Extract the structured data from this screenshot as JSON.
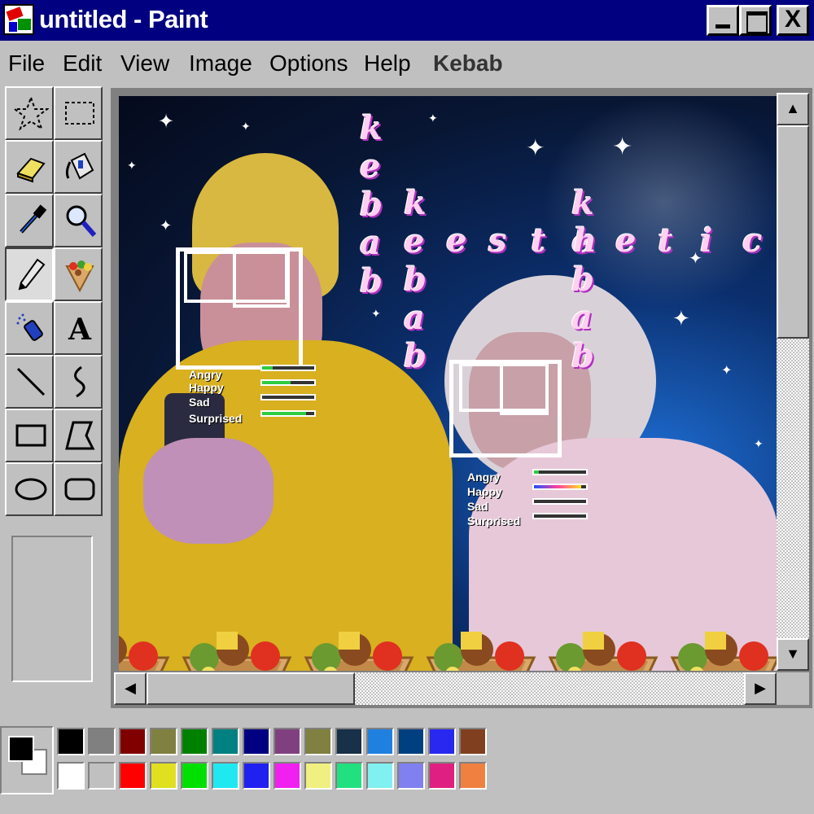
{
  "window": {
    "title": "untitled - Paint",
    "close_glyph": "X"
  },
  "menu": [
    {
      "label": "File"
    },
    {
      "label": "Edit"
    },
    {
      "label": "View"
    },
    {
      "label": "Image"
    },
    {
      "label": "Options"
    },
    {
      "label": "Help"
    },
    {
      "label": "Kebab"
    }
  ],
  "tools": [
    {
      "name": "free-form-select",
      "icon": "star-select-icon"
    },
    {
      "name": "select",
      "icon": "rect-select-icon"
    },
    {
      "name": "eraser",
      "icon": "eraser-icon"
    },
    {
      "name": "fill-with-color",
      "icon": "paint-bucket-icon"
    },
    {
      "name": "pick-color",
      "icon": "eyedropper-icon"
    },
    {
      "name": "magnifier",
      "icon": "magnifier-icon"
    },
    {
      "name": "pencil",
      "icon": "pencil-icon",
      "pressed": true
    },
    {
      "name": "kebab",
      "icon": "kebab-icon"
    },
    {
      "name": "airbrush",
      "icon": "airbrush-icon"
    },
    {
      "name": "text",
      "icon": "text-icon",
      "glyph": "A"
    },
    {
      "name": "line",
      "icon": "line-icon"
    },
    {
      "name": "curve",
      "icon": "curve-icon"
    },
    {
      "name": "rectangle",
      "icon": "rectangle-icon"
    },
    {
      "name": "polygon",
      "icon": "polygon-icon"
    },
    {
      "name": "ellipse",
      "icon": "ellipse-icon"
    },
    {
      "name": "rounded-rectangle",
      "icon": "rounded-rectangle-icon"
    }
  ],
  "canvas": {
    "emotion_panels": [
      {
        "labels": [
          "Angry",
          "Happy",
          "Sad",
          "Surprised"
        ],
        "levels": [
          0.2,
          0.55,
          0.0,
          0.85
        ]
      },
      {
        "labels": [
          "Angry",
          "Happy",
          "Sad",
          "Surprised"
        ],
        "levels": [
          0.1,
          0.9,
          0.0,
          0.0
        ]
      }
    ],
    "vertical_words": [
      "kebab",
      "kebab",
      "kebab"
    ],
    "horizontal_word": "kesthetics"
  },
  "palette": {
    "foreground": "#000000",
    "background": "#ffffff",
    "top_row": [
      "#000000",
      "#808080",
      "#800000",
      "#808040",
      "#008000",
      "#008080",
      "#000080",
      "#804080",
      "#808040",
      "#183048",
      "#2080e0",
      "#004080",
      "#2828f0",
      "#804020"
    ],
    "bottom_row": [
      "#ffffff",
      "#c0c0c0",
      "#ff0000",
      "#e0e020",
      "#00e000",
      "#20e8f0",
      "#2020f0",
      "#f020f0",
      "#f0f080",
      "#20e080",
      "#80f0f0",
      "#8080f0",
      "#e02080",
      "#f08040"
    ]
  },
  "scroll": {
    "up": "▲",
    "down": "▼",
    "left": "◀",
    "right": "▶"
  }
}
